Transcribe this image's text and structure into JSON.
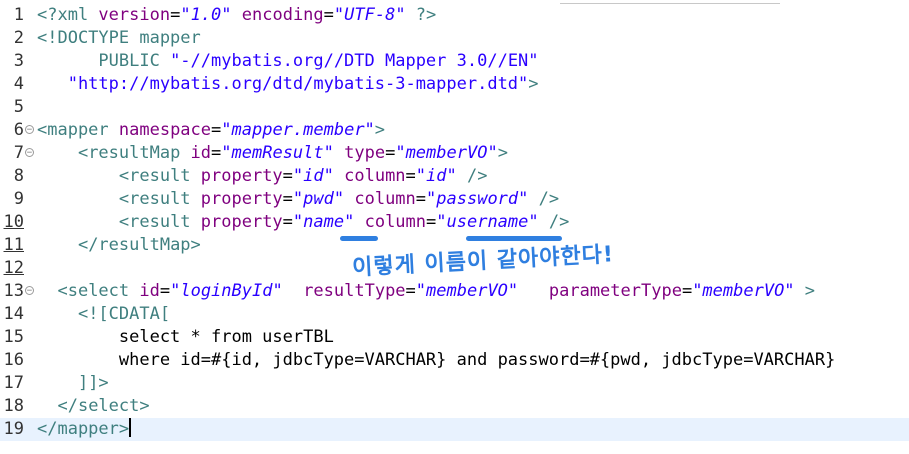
{
  "lines": [
    {
      "n": "1",
      "parts": [
        [
          "pi",
          "<?xml "
        ],
        [
          "attr",
          "version"
        ],
        [
          "txt",
          "="
        ],
        [
          "val",
          "\"1.0\""
        ],
        [
          "txt",
          " "
        ],
        [
          "attr",
          "encoding"
        ],
        [
          "txt",
          "="
        ],
        [
          "val",
          "\"UTF-8\""
        ],
        [
          "pi",
          " ?>"
        ]
      ]
    },
    {
      "n": "2",
      "parts": [
        [
          "tag",
          "<!DOCTYPE mapper"
        ]
      ]
    },
    {
      "n": "3",
      "parts": [
        [
          "tag",
          "      PUBLIC "
        ],
        [
          "val2",
          "\"-//mybatis.org//DTD Mapper 3.0//EN\""
        ]
      ]
    },
    {
      "n": "4",
      "parts": [
        [
          "val2",
          "   \"http://mybatis.org/dtd/mybatis-3-mapper.dtd\""
        ],
        [
          "tag",
          ">"
        ]
      ]
    },
    {
      "n": "5",
      "parts": []
    },
    {
      "n": "6",
      "fold": true,
      "parts": [
        [
          "tag",
          "<mapper "
        ],
        [
          "attr",
          "namespace"
        ],
        [
          "txt",
          "="
        ],
        [
          "val",
          "\"mapper.member\""
        ],
        [
          "tag",
          ">"
        ]
      ]
    },
    {
      "n": "7",
      "fold": true,
      "parts": [
        [
          "txt",
          "    "
        ],
        [
          "tag",
          "<resultMap "
        ],
        [
          "attr",
          "id"
        ],
        [
          "txt",
          "="
        ],
        [
          "val",
          "\"memResult\""
        ],
        [
          "txt",
          " "
        ],
        [
          "attr",
          "type"
        ],
        [
          "txt",
          "="
        ],
        [
          "val",
          "\"memberVO\""
        ],
        [
          "tag",
          ">"
        ]
      ]
    },
    {
      "n": "8",
      "parts": [
        [
          "txt",
          "        "
        ],
        [
          "tag",
          "<result "
        ],
        [
          "attr",
          "property"
        ],
        [
          "txt",
          "="
        ],
        [
          "val",
          "\"id\""
        ],
        [
          "txt",
          " "
        ],
        [
          "attr",
          "column"
        ],
        [
          "txt",
          "="
        ],
        [
          "val",
          "\"id\""
        ],
        [
          "txt",
          " "
        ],
        [
          "tag",
          "/>"
        ]
      ]
    },
    {
      "n": "9",
      "parts": [
        [
          "txt",
          "        "
        ],
        [
          "tag",
          "<result "
        ],
        [
          "attr",
          "property"
        ],
        [
          "txt",
          "="
        ],
        [
          "val",
          "\"pwd\""
        ],
        [
          "txt",
          " "
        ],
        [
          "attr",
          "column"
        ],
        [
          "txt",
          "="
        ],
        [
          "val",
          "\"password\""
        ],
        [
          "txt",
          " "
        ],
        [
          "tag",
          "/>"
        ]
      ]
    },
    {
      "n": "10",
      "ul": true,
      "parts": [
        [
          "txt",
          "        "
        ],
        [
          "tag",
          "<result "
        ],
        [
          "attr",
          "property"
        ],
        [
          "txt",
          "="
        ],
        [
          "val",
          "\"name\""
        ],
        [
          "txt",
          " "
        ],
        [
          "attr",
          "column"
        ],
        [
          "txt",
          "="
        ],
        [
          "val",
          "\"username\""
        ],
        [
          "txt",
          " "
        ],
        [
          "tag",
          "/>"
        ]
      ]
    },
    {
      "n": "11",
      "ul": true,
      "parts": [
        [
          "txt",
          "    "
        ],
        [
          "tag",
          "</resultMap>"
        ]
      ]
    },
    {
      "n": "12",
      "ul": true,
      "parts": []
    },
    {
      "n": "13",
      "fold": true,
      "parts": [
        [
          "txt",
          "  "
        ],
        [
          "tag",
          "<select "
        ],
        [
          "attr",
          "id"
        ],
        [
          "txt",
          "="
        ],
        [
          "val",
          "\"loginById\""
        ],
        [
          "txt",
          "  "
        ],
        [
          "attr",
          "resultType"
        ],
        [
          "txt",
          "="
        ],
        [
          "val",
          "\"memberVO\""
        ],
        [
          "txt",
          "   "
        ],
        [
          "attr",
          "parameterType"
        ],
        [
          "txt",
          "="
        ],
        [
          "val",
          "\"memberVO\""
        ],
        [
          "txt",
          " "
        ],
        [
          "tag",
          ">"
        ]
      ]
    },
    {
      "n": "14",
      "parts": [
        [
          "txt",
          "    "
        ],
        [
          "cdata",
          "<![CDATA["
        ]
      ]
    },
    {
      "n": "15",
      "parts": [
        [
          "txt",
          "        select * from userTBL"
        ]
      ]
    },
    {
      "n": "16",
      "parts": [
        [
          "txt",
          "        where id=#{id, jdbcType=VARCHAR} and password=#{pwd, jdbcType=VARCHAR}"
        ]
      ]
    },
    {
      "n": "17",
      "parts": [
        [
          "txt",
          "    "
        ],
        [
          "cdata",
          "]]>"
        ]
      ]
    },
    {
      "n": "18",
      "parts": [
        [
          "txt",
          "  "
        ],
        [
          "tag",
          "</select>"
        ]
      ]
    },
    {
      "n": "19",
      "current": true,
      "caret": true,
      "parts": [
        [
          "tag",
          "</mapper>"
        ]
      ]
    }
  ],
  "annotation": {
    "text": "이렇게 이름이 같아야한다!",
    "color": "#2f7fe0"
  }
}
